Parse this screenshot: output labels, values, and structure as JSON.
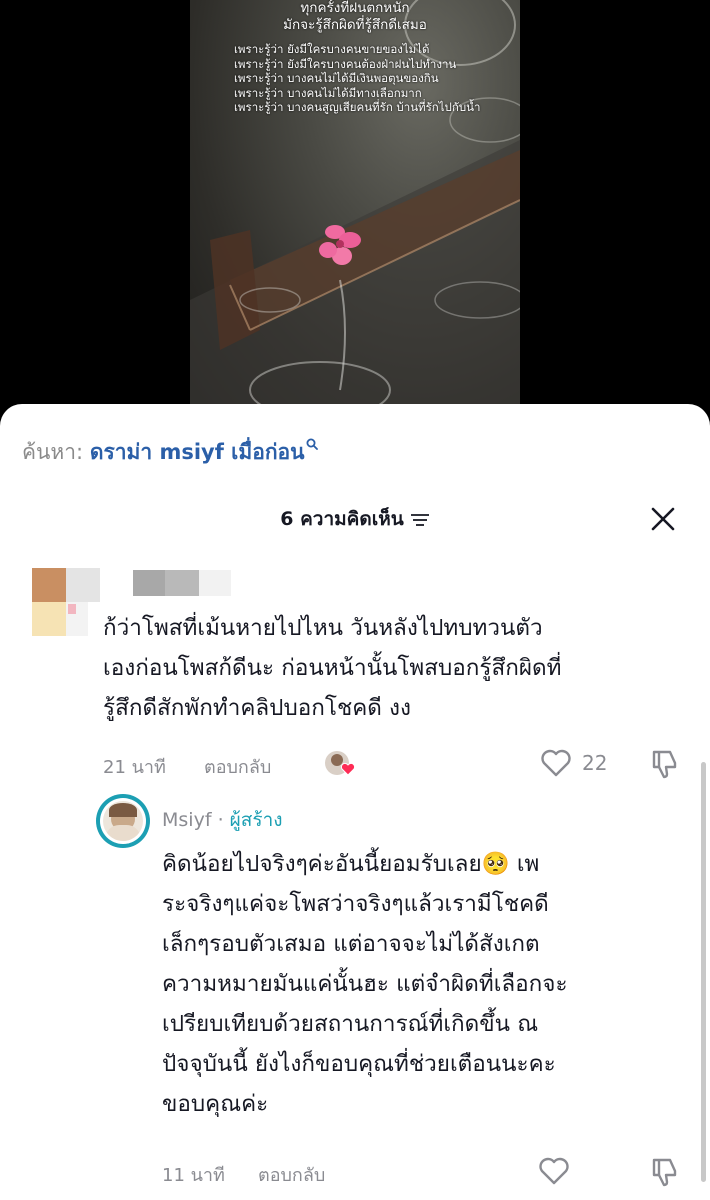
{
  "video": {
    "title_line1": "ทุกครั้งที่ฝนตกหนัก",
    "title_line2": "มักจะรู้สึกผิดที่รู้สึกดีเสมอ",
    "lines": [
      "เพราะรู้ว่า ยังมีใครบางคนขายของไม่ได้",
      "เพราะรู้ว่า ยังมีใครบางคนต้องฝ่าฝนไปทำงาน",
      "เพราะรู้ว่า บางคนไม่ได้มีเงินพอตุนของกิน",
      "เพราะรู้ว่า บางคนไม่ได้มีทางเลือกมาก",
      "เพราะรู้ว่า บางคนสูญเสียคนที่รัก บ้านที่รักไปกับน้ำ"
    ]
  },
  "search": {
    "label": "ค้นหา:",
    "query": "ดราม่า msiyf เมื่อก่อน",
    "icon": "search-icon"
  },
  "comments_header": {
    "title": "6 ความคิดเห็น",
    "sort_icon": "sort-icon",
    "close_icon": "close-icon"
  },
  "comment1": {
    "lines": [
      "ก้ว่าโพสที่เม้นหายไปไหน วันหลังไปทบทวนตัว",
      "เองก่อนโพสก้ดีนะ ก่อนหน้านั้นโพสบอกรู้สึกผิดที่",
      "รู้สึกดีสักพักทำคลิปบอกโชคดี งง"
    ],
    "time": "21 นาที",
    "reply_label": "ตอบกลับ",
    "likes": "22"
  },
  "reply1": {
    "username": "Msiyf",
    "separator": "·",
    "badge": "ผู้สร้าง",
    "lines": [
      "คิดน้อยไปจริงๆค่ะอันนี้ยอมรับเลย",
      "ระจริงๆแค่จะโพสว่าจริงๆแล้วเรามีโชคดี",
      "เล็กๆรอบตัวเสมอ แต่อาจจะไม่ได้สังเกต",
      "ความหมายมันแค่นั้นฮะ แต่จำผิดที่เลือกจะ",
      "เปรียบเทียบด้วยสถานการณ์ที่เกิดขึ้น ณ",
      "ปัจจุบันนี้ ยังไงก็ขอบคุณที่ช่วยเตือนนะคะ",
      "ขอบคุณค่ะ"
    ],
    "emoji": "🥺",
    "line1_tail": "เพ",
    "time": "11 นาที",
    "reply_label": "ตอบกลับ"
  },
  "colors": {
    "link": "#2b5fa8",
    "creator": "#1c9fb3",
    "muted": "#8a8b91",
    "text": "#161823"
  }
}
